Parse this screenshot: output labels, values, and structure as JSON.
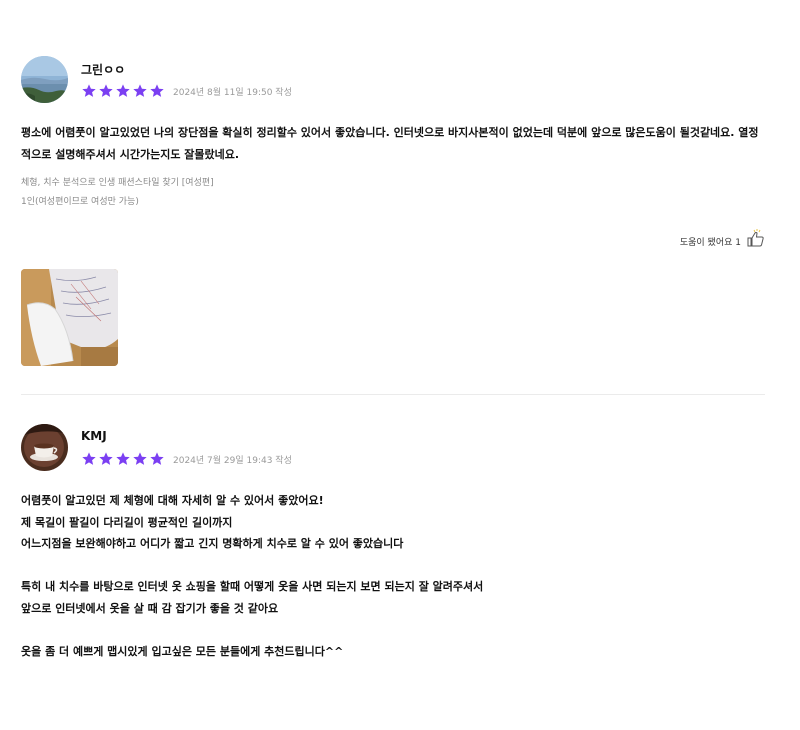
{
  "reviews": [
    {
      "author": "그린ㅇㅇ",
      "rating": 5,
      "avatar_icon": "landscape-avatar",
      "date": "2024년 8월 11일 19:50 작성",
      "body": "평소에 어렴풋이 알고있었던 나의 장단점을 확실히 정리할수 있어서 좋았습니다. 인터넷으로 바지사본적이 없었는데 덕분에 앞으로 많은도움이 될것같네요. 열정적으로 설명해주셔서 시간가는지도 잘몰랐네요.",
      "option_line1": "체형, 치수 분석으로 인생 패션스타일 찾기 [여성편]",
      "option_line2": "1인(여성편이므로 여성만 가능)",
      "helpful_label": "도움이 됐어요 1",
      "helpful_icon": "thumbs-up-icon",
      "photo_icon": "review-photo"
    },
    {
      "author": "KMJ",
      "rating": 5,
      "avatar_icon": "coffee-cup-avatar",
      "date": "2024년 7월 29일 19:43 작성",
      "body": "어렴풋이 알고있던 제 체형에 대해 자세히 알 수 있어서 좋았어요!\n제 목길이 팔길이 다리길이 평균적인 길이까지\n어느지점을 보완해야하고 어디가 짧고 긴지 명확하게 치수로 알 수 있어 좋았습니다\n\n특히 내 치수를 바탕으로 인터넷 옷 쇼핑을 할때 어떻게 옷을 사면 되는지 보면 되는지 잘 알려주셔서\n앞으로 인터넷에서 옷을 살 때 감 잡기가 좋을 것 같아요\n\n옷을 좀 더 예쁘게 맵시있게 입고싶은 모든 분들에게 추천드립니다^^"
    }
  ],
  "colors": {
    "star": "#7B3FF2",
    "date": "#9a9a9a",
    "divider": "#ebebeb"
  }
}
